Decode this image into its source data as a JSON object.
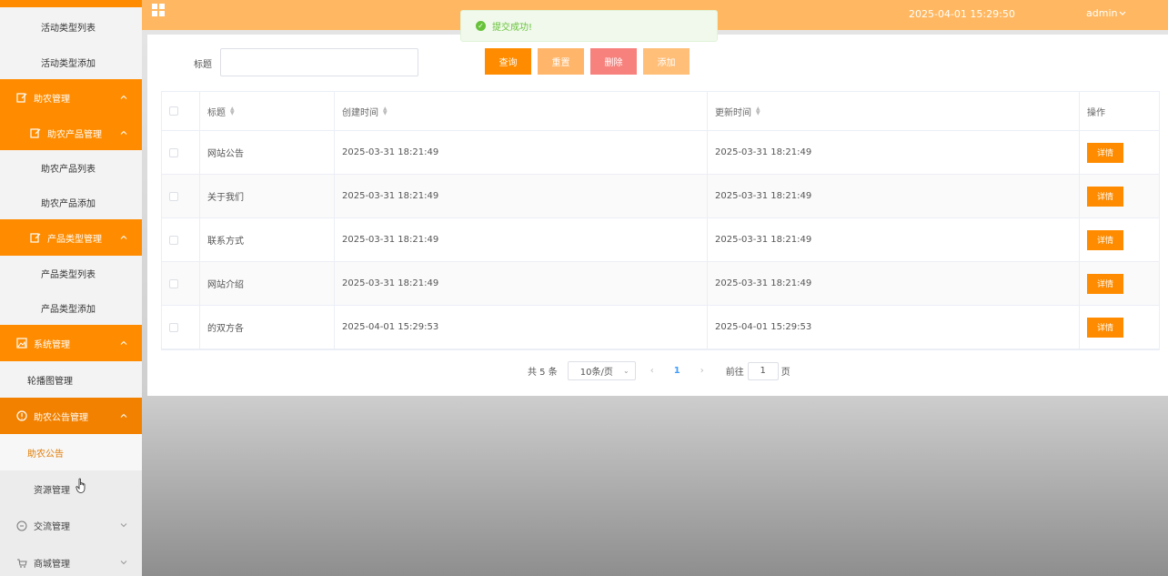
{
  "sidebar": {
    "items": [
      {
        "label": "活动类型列表"
      },
      {
        "label": "活动类型添加"
      },
      {
        "label": "助农管理"
      },
      {
        "label": "助农产品管理"
      },
      {
        "label": "助农产品列表"
      },
      {
        "label": "助农产品添加"
      },
      {
        "label": "产品类型管理"
      },
      {
        "label": "产品类型列表"
      },
      {
        "label": "产品类型添加"
      },
      {
        "label": "系统管理"
      },
      {
        "label": "轮播图管理"
      },
      {
        "label": "助农公告管理"
      },
      {
        "label": "助农公告"
      },
      {
        "label": "资源管理"
      },
      {
        "label": "交流管理"
      },
      {
        "label": "商城管理"
      }
    ]
  },
  "topbar": {
    "datetime": "2025-04-01 15:29:50",
    "user": "admin"
  },
  "toast": {
    "message": "提交成功!"
  },
  "search": {
    "label": "标题",
    "value": "",
    "placeholder": ""
  },
  "buttons": {
    "query": "查询",
    "reset": "重置",
    "delete": "删除",
    "add": "添加"
  },
  "table": {
    "headers": {
      "title": "标题",
      "created": "创建时间",
      "updated": "更新时间",
      "ops": "操作"
    },
    "rows": [
      {
        "title": "网站公告",
        "created": "2025-03-31 18:21:49",
        "updated": "2025-03-31 18:21:49",
        "action": "详情"
      },
      {
        "title": "关于我们",
        "created": "2025-03-31 18:21:49",
        "updated": "2025-03-31 18:21:49",
        "action": "详情"
      },
      {
        "title": "联系方式",
        "created": "2025-03-31 18:21:49",
        "updated": "2025-03-31 18:21:49",
        "action": "详情"
      },
      {
        "title": "网站介绍",
        "created": "2025-03-31 18:21:49",
        "updated": "2025-03-31 18:21:49",
        "action": "详情"
      },
      {
        "title": "的双方各",
        "created": "2025-04-01 15:29:53",
        "updated": "2025-04-01 15:29:53",
        "action": "详情"
      }
    ]
  },
  "pagination": {
    "total": "共 5 条",
    "page_size": "10条/页",
    "current_page": "1",
    "goto_label": "前往",
    "goto_value": "1",
    "page_suffix": "页"
  },
  "colors": {
    "accent": "#ff8c00",
    "topbar": "#ffb861",
    "success": "#67c23a",
    "danger": "#f7827d"
  }
}
